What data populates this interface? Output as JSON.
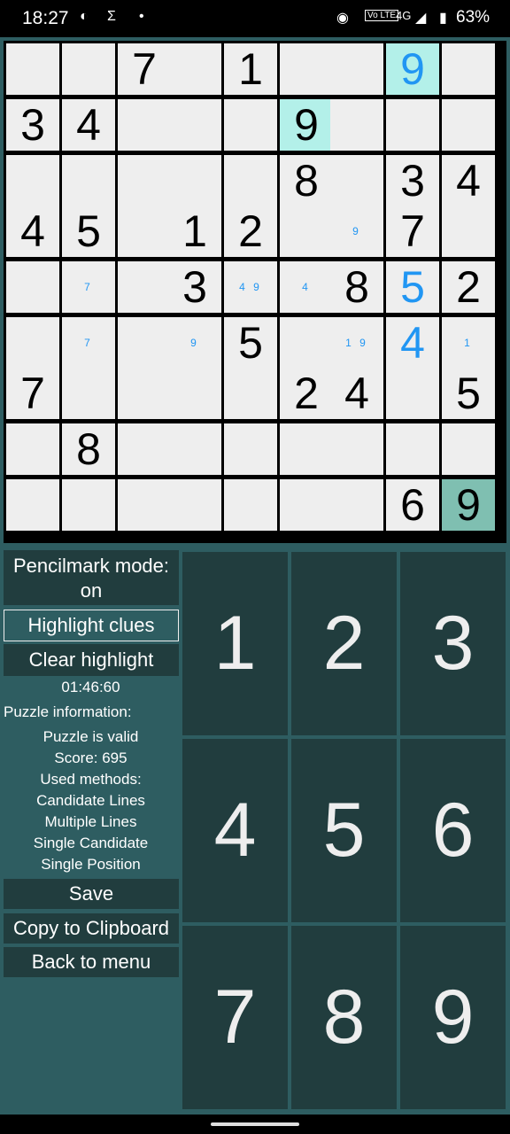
{
  "status_bar": {
    "time": "18:27",
    "battery": "63%",
    "network": "4G",
    "volte": "Vo LTE"
  },
  "board": {
    "rows": [
      [
        "",
        "",
        "7",
        "",
        "1",
        "",
        "",
        "9",
        ""
      ],
      [
        "3",
        "4",
        "",
        "",
        "",
        "9",
        "",
        "",
        ""
      ],
      [
        "",
        "",
        "",
        "",
        "",
        "8",
        "",
        "3",
        "4"
      ],
      [
        "4",
        "5",
        "",
        "1",
        "2",
        "",
        "",
        "7",
        ""
      ],
      [
        "",
        "",
        "",
        "3",
        "",
        "",
        "8",
        "5",
        "2"
      ],
      [
        "",
        "",
        "",
        "",
        "5",
        "",
        "",
        "4",
        ""
      ],
      [
        "7",
        "",
        "",
        "",
        "",
        "2",
        "4",
        "",
        "5"
      ],
      [
        "",
        "8",
        "",
        "",
        "",
        "",
        "",
        "",
        ""
      ],
      [
        "",
        "",
        "",
        "",
        "",
        "",
        "",
        "6",
        "9"
      ]
    ],
    "pencilmarks": [
      [
        "",
        "",
        "",
        "",
        "",
        "",
        "",
        "",
        ""
      ],
      [
        "",
        "",
        "",
        "",
        "",
        "",
        "",
        "",
        ""
      ],
      [
        "",
        "",
        "",
        "",
        "",
        "",
        "",
        "",
        ""
      ],
      [
        "",
        "",
        "",
        "",
        "",
        "",
        "9",
        "",
        ""
      ],
      [
        "",
        "7",
        "",
        "",
        "4 9",
        "4",
        "",
        "",
        ""
      ],
      [
        "",
        "7",
        "",
        "9",
        "",
        "",
        "1 9",
        "",
        "1"
      ],
      [
        "",
        "",
        "",
        "",
        "",
        "",
        "",
        "",
        ""
      ],
      [
        "",
        "",
        "",
        "",
        "",
        "",
        "",
        "",
        ""
      ],
      [
        "",
        "",
        "",
        "",
        "",
        "",
        "",
        "",
        ""
      ]
    ],
    "user_entered": [
      [
        0,
        7
      ],
      [
        4,
        7
      ],
      [
        5,
        7
      ]
    ],
    "highlighted_cells": [
      [
        0,
        7
      ],
      [
        1,
        5
      ]
    ],
    "selected_cell": [
      8,
      8
    ]
  },
  "controls": {
    "pencilmark_mode": "Pencilmark mode: on",
    "highlight_clues": "Highlight clues",
    "clear_highlight": "Clear highlight",
    "timer": "01:46:60",
    "save": "Save",
    "copy_to_clipboard": "Copy to Clipboard",
    "back_to_menu": "Back to menu"
  },
  "puzzle_info": {
    "heading": "Puzzle information:",
    "validity": "Puzzle is valid",
    "score": "Score: 695",
    "methods_heading": "Used methods:",
    "methods": [
      "Candidate Lines",
      "Multiple Lines",
      "Single Candidate",
      "Single Position"
    ]
  },
  "number_pad": [
    "1",
    "2",
    "3",
    "4",
    "5",
    "6",
    "7",
    "8",
    "9"
  ],
  "colors": {
    "background": "#2e5d61",
    "button": "#213d3e",
    "cell": "#eeeeee",
    "highlight": "#b3f0e9",
    "selected": "#7fbfb1",
    "user_digit": "#2196f3"
  }
}
